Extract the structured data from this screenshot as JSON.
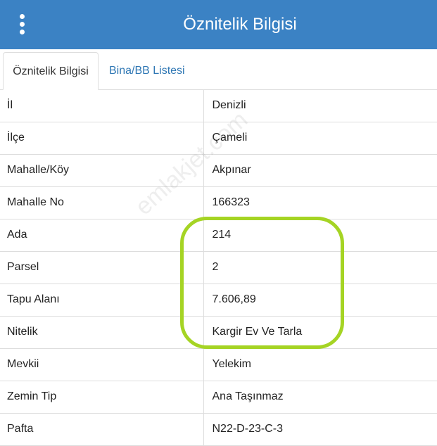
{
  "header": {
    "title": "Öznitelik Bilgisi",
    "menu_icon": "vertical-dots-icon",
    "background_color": "#3b82c4"
  },
  "tabs": [
    {
      "label": "Öznitelik Bilgisi",
      "active": true
    },
    {
      "label": "Bina/BB Listesi",
      "active": false
    }
  ],
  "rows": [
    {
      "key": "İl",
      "value": "Denizli"
    },
    {
      "key": "İlçe",
      "value": "Çameli"
    },
    {
      "key": "Mahalle/Köy",
      "value": "Akpınar"
    },
    {
      "key": "Mahalle No",
      "value": "166323"
    },
    {
      "key": "Ada",
      "value": "214"
    },
    {
      "key": "Parsel",
      "value": "2"
    },
    {
      "key": "Tapu Alanı",
      "value": "7.606,89"
    },
    {
      "key": "Nitelik",
      "value": "Kargir Ev Ve Tarla"
    },
    {
      "key": "Mevkii",
      "value": "Yelekim"
    },
    {
      "key": "Zemin Tip",
      "value": "Ana Taşınmaz"
    },
    {
      "key": "Pafta",
      "value": "N22-D-23-C-3"
    }
  ],
  "watermark": "emlakjet.com",
  "highlight_color": "#a5d424"
}
